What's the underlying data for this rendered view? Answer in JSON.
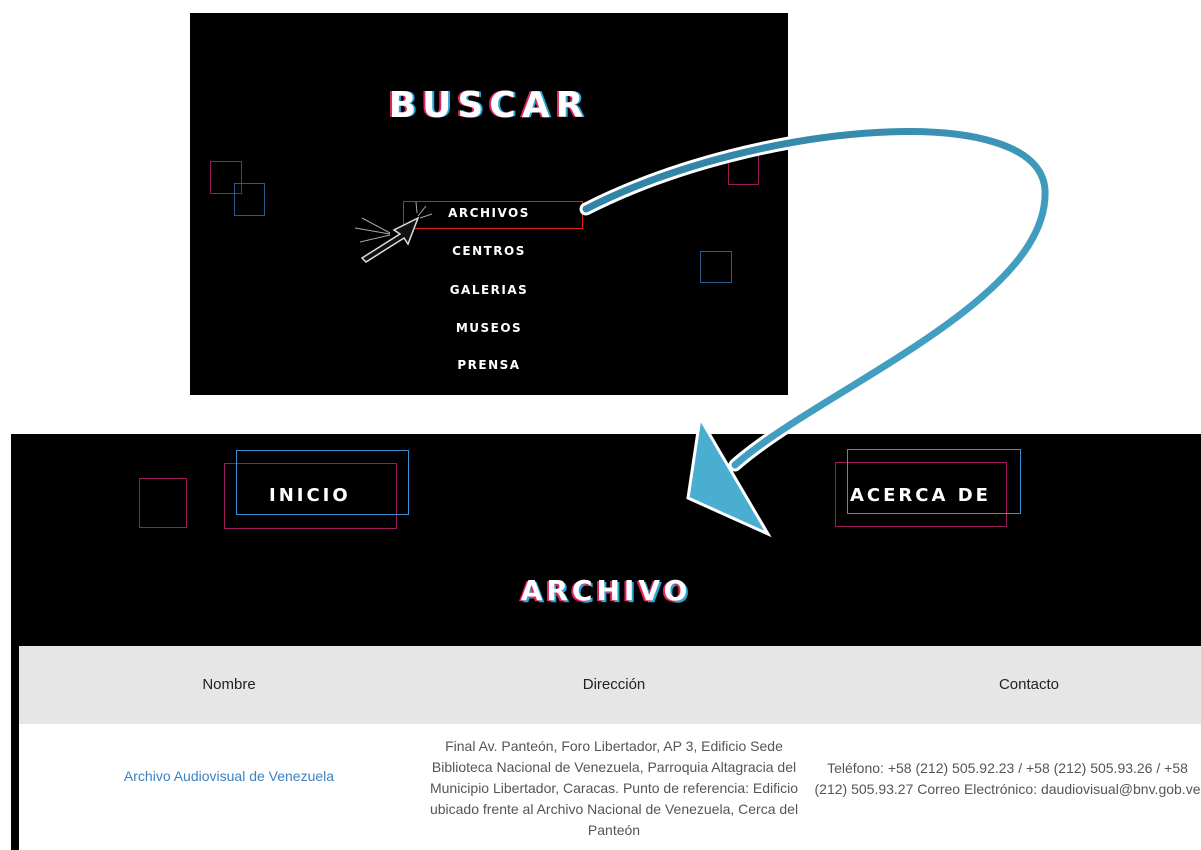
{
  "top_panel": {
    "title": "BUSCAR",
    "menu": [
      "ARCHIVOS",
      "CENTROS",
      "GALERIAS",
      "MUSEOS",
      "PRENSA"
    ]
  },
  "bottom_panel": {
    "nav": {
      "home": "INICIO",
      "about": "ACERCA DE"
    },
    "section_title": "ARCHIVO",
    "table": {
      "headers": [
        "Nombre",
        "Dirección",
        "Contacto"
      ],
      "rows": [
        {
          "name": "Archivo Audiovisual de Venezuela",
          "address": "Final Av. Panteón, Foro Libertador, AP 3, Edificio Sede Biblioteca Nacional de Venezuela, Parroquia Altagracia del Municipio Libertador, Caracas. Punto de referencia: Edificio ubicado frente al Archivo Nacional de Venezuela, Cerca del Panteón",
          "contact": "Teléfono: +58 (212) 505.92.23 / +58 (212) 505.93.26 / +58 (212) 505.93.27 Correo Electrónico: daudiovisual@bnv.gob.ve"
        }
      ]
    }
  },
  "colors": {
    "accent_pink": "#e0245e",
    "accent_blue": "#2aa6d6",
    "highlight_red": "#e41b1b",
    "link": "#3b82c4"
  },
  "icons": [
    "cursor-arrow-icon",
    "curved-arrow-icon"
  ]
}
